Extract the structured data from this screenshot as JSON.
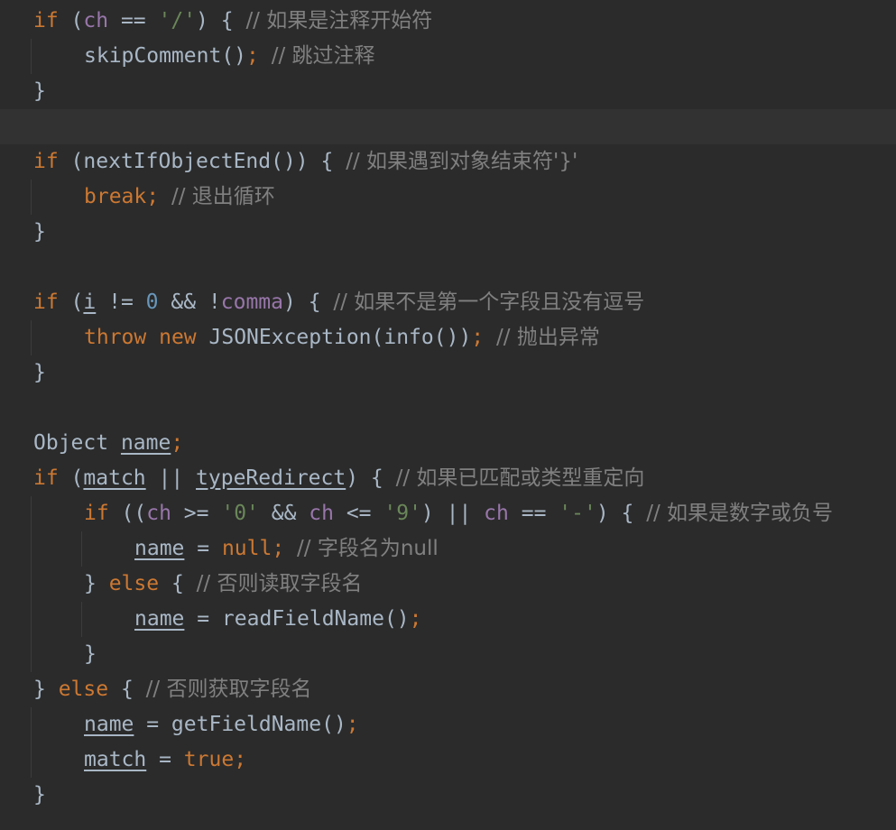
{
  "editor": {
    "lines": [
      {
        "indent": 0,
        "tokens": [
          {
            "t": "if",
            "c": "kw"
          },
          {
            "t": " (",
            "c": "plain"
          },
          {
            "t": "ch",
            "c": "field"
          },
          {
            "t": " == ",
            "c": "plain"
          },
          {
            "t": "'/'",
            "c": "str"
          },
          {
            "t": ") { ",
            "c": "plain"
          },
          {
            "t": "// 如果是注释开始符",
            "c": "cmt"
          }
        ]
      },
      {
        "indent": 1,
        "tokens": [
          {
            "t": "skipComment()",
            "c": "plain"
          },
          {
            "t": ";",
            "c": "punct"
          },
          {
            "t": " ",
            "c": "plain"
          },
          {
            "t": "// 跳过注释",
            "c": "cmt"
          }
        ]
      },
      {
        "indent": 0,
        "tokens": [
          {
            "t": "}",
            "c": "plain"
          }
        ]
      },
      {
        "indent": 0,
        "current": true,
        "tokens": []
      },
      {
        "indent": 0,
        "tokens": [
          {
            "t": "if",
            "c": "kw"
          },
          {
            "t": " (nextIfObjectEnd()) { ",
            "c": "plain"
          },
          {
            "t": "// 如果遇到对象结束符'}'",
            "c": "cmt"
          }
        ]
      },
      {
        "indent": 1,
        "tokens": [
          {
            "t": "break",
            "c": "kw"
          },
          {
            "t": ";",
            "c": "punct"
          },
          {
            "t": " ",
            "c": "plain"
          },
          {
            "t": "// 退出循环",
            "c": "cmt"
          }
        ]
      },
      {
        "indent": 0,
        "tokens": [
          {
            "t": "}",
            "c": "plain"
          }
        ]
      },
      {
        "indent": 0,
        "tokens": []
      },
      {
        "indent": 0,
        "tokens": [
          {
            "t": "if",
            "c": "kw"
          },
          {
            "t": " (",
            "c": "plain"
          },
          {
            "t": "i",
            "c": "ul"
          },
          {
            "t": " != ",
            "c": "plain"
          },
          {
            "t": "0",
            "c": "num"
          },
          {
            "t": " && !",
            "c": "plain"
          },
          {
            "t": "comma",
            "c": "field"
          },
          {
            "t": ") { ",
            "c": "plain"
          },
          {
            "t": "// 如果不是第一个字段且没有逗号",
            "c": "cmt"
          }
        ]
      },
      {
        "indent": 1,
        "tokens": [
          {
            "t": "throw",
            "c": "kw"
          },
          {
            "t": " ",
            "c": "plain"
          },
          {
            "t": "new",
            "c": "kw"
          },
          {
            "t": " JSONException(info())",
            "c": "plain"
          },
          {
            "t": ";",
            "c": "punct"
          },
          {
            "t": " ",
            "c": "plain"
          },
          {
            "t": "// 抛出异常",
            "c": "cmt"
          }
        ]
      },
      {
        "indent": 0,
        "tokens": [
          {
            "t": "}",
            "c": "plain"
          }
        ]
      },
      {
        "indent": 0,
        "tokens": []
      },
      {
        "indent": 0,
        "tokens": [
          {
            "t": "Object ",
            "c": "plain"
          },
          {
            "t": "name",
            "c": "ul"
          },
          {
            "t": ";",
            "c": "punct"
          }
        ]
      },
      {
        "indent": 0,
        "tokens": [
          {
            "t": "if",
            "c": "kw"
          },
          {
            "t": " (",
            "c": "plain"
          },
          {
            "t": "match",
            "c": "ul"
          },
          {
            "t": " || ",
            "c": "plain"
          },
          {
            "t": "typeRedirect",
            "c": "ul"
          },
          {
            "t": ") { ",
            "c": "plain"
          },
          {
            "t": "// 如果已匹配或类型重定向",
            "c": "cmt"
          }
        ]
      },
      {
        "indent": 1,
        "tokens": [
          {
            "t": "if",
            "c": "kw"
          },
          {
            "t": " ((",
            "c": "plain"
          },
          {
            "t": "ch",
            "c": "field"
          },
          {
            "t": " >= ",
            "c": "plain"
          },
          {
            "t": "'0'",
            "c": "str"
          },
          {
            "t": " && ",
            "c": "plain"
          },
          {
            "t": "ch",
            "c": "field"
          },
          {
            "t": " <= ",
            "c": "plain"
          },
          {
            "t": "'9'",
            "c": "str"
          },
          {
            "t": ") || ",
            "c": "plain"
          },
          {
            "t": "ch",
            "c": "field"
          },
          {
            "t": " == ",
            "c": "plain"
          },
          {
            "t": "'-'",
            "c": "str"
          },
          {
            "t": ") { ",
            "c": "plain"
          },
          {
            "t": "// 如果是数字或负号",
            "c": "cmt"
          }
        ]
      },
      {
        "indent": 2,
        "tokens": [
          {
            "t": "name",
            "c": "ul"
          },
          {
            "t": " = ",
            "c": "plain"
          },
          {
            "t": "null",
            "c": "kw"
          },
          {
            "t": ";",
            "c": "punct"
          },
          {
            "t": " ",
            "c": "plain"
          },
          {
            "t": "// 字段名为null",
            "c": "cmt"
          }
        ]
      },
      {
        "indent": 1,
        "tokens": [
          {
            "t": "} ",
            "c": "plain"
          },
          {
            "t": "else",
            "c": "kw"
          },
          {
            "t": " { ",
            "c": "plain"
          },
          {
            "t": "// 否则读取字段名",
            "c": "cmt"
          }
        ]
      },
      {
        "indent": 2,
        "tokens": [
          {
            "t": "name",
            "c": "ul"
          },
          {
            "t": " = readFieldName()",
            "c": "plain"
          },
          {
            "t": ";",
            "c": "punct"
          }
        ]
      },
      {
        "indent": 1,
        "tokens": [
          {
            "t": "}",
            "c": "plain"
          }
        ]
      },
      {
        "indent": 0,
        "tokens": [
          {
            "t": "} ",
            "c": "plain"
          },
          {
            "t": "else",
            "c": "kw"
          },
          {
            "t": " { ",
            "c": "plain"
          },
          {
            "t": "// 否则获取字段名",
            "c": "cmt"
          }
        ]
      },
      {
        "indent": 1,
        "tokens": [
          {
            "t": "name",
            "c": "ul"
          },
          {
            "t": " = getFieldName()",
            "c": "plain"
          },
          {
            "t": ";",
            "c": "punct"
          }
        ]
      },
      {
        "indent": 1,
        "tokens": [
          {
            "t": "match",
            "c": "ul"
          },
          {
            "t": " = ",
            "c": "plain"
          },
          {
            "t": "true",
            "c": "kw"
          },
          {
            "t": ";",
            "c": "punct"
          }
        ]
      },
      {
        "indent": 0,
        "tokens": [
          {
            "t": "}",
            "c": "plain"
          }
        ]
      }
    ]
  },
  "colors": {
    "background": "#2b2b2b",
    "current_line": "#323232",
    "keyword": "#cc7832",
    "string": "#6a8759",
    "number": "#6897bb",
    "field": "#9876aa",
    "comment": "#808080",
    "identifier": "#a9b7c6"
  }
}
